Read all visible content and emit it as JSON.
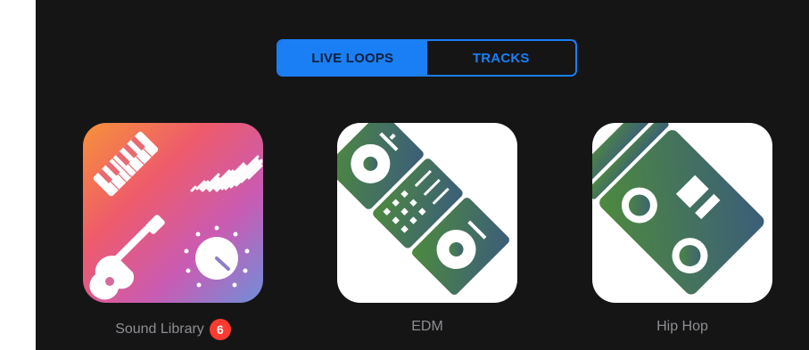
{
  "tabs": [
    {
      "label": "LIVE LOOPS",
      "active": true
    },
    {
      "label": "TRACKS",
      "active": false
    }
  ],
  "colors": {
    "accent": "#1a7ff5",
    "background": "#151516",
    "label": "#8e8e93",
    "badge": "#ff3b30"
  },
  "templates": [
    {
      "label": "Sound Library",
      "badge": "6",
      "icon": "sound-library-icon"
    },
    {
      "label": "EDM",
      "icon": "edm-turntable-icon"
    },
    {
      "label": "Hip Hop",
      "icon": "hip-hop-boombox-icon"
    }
  ]
}
